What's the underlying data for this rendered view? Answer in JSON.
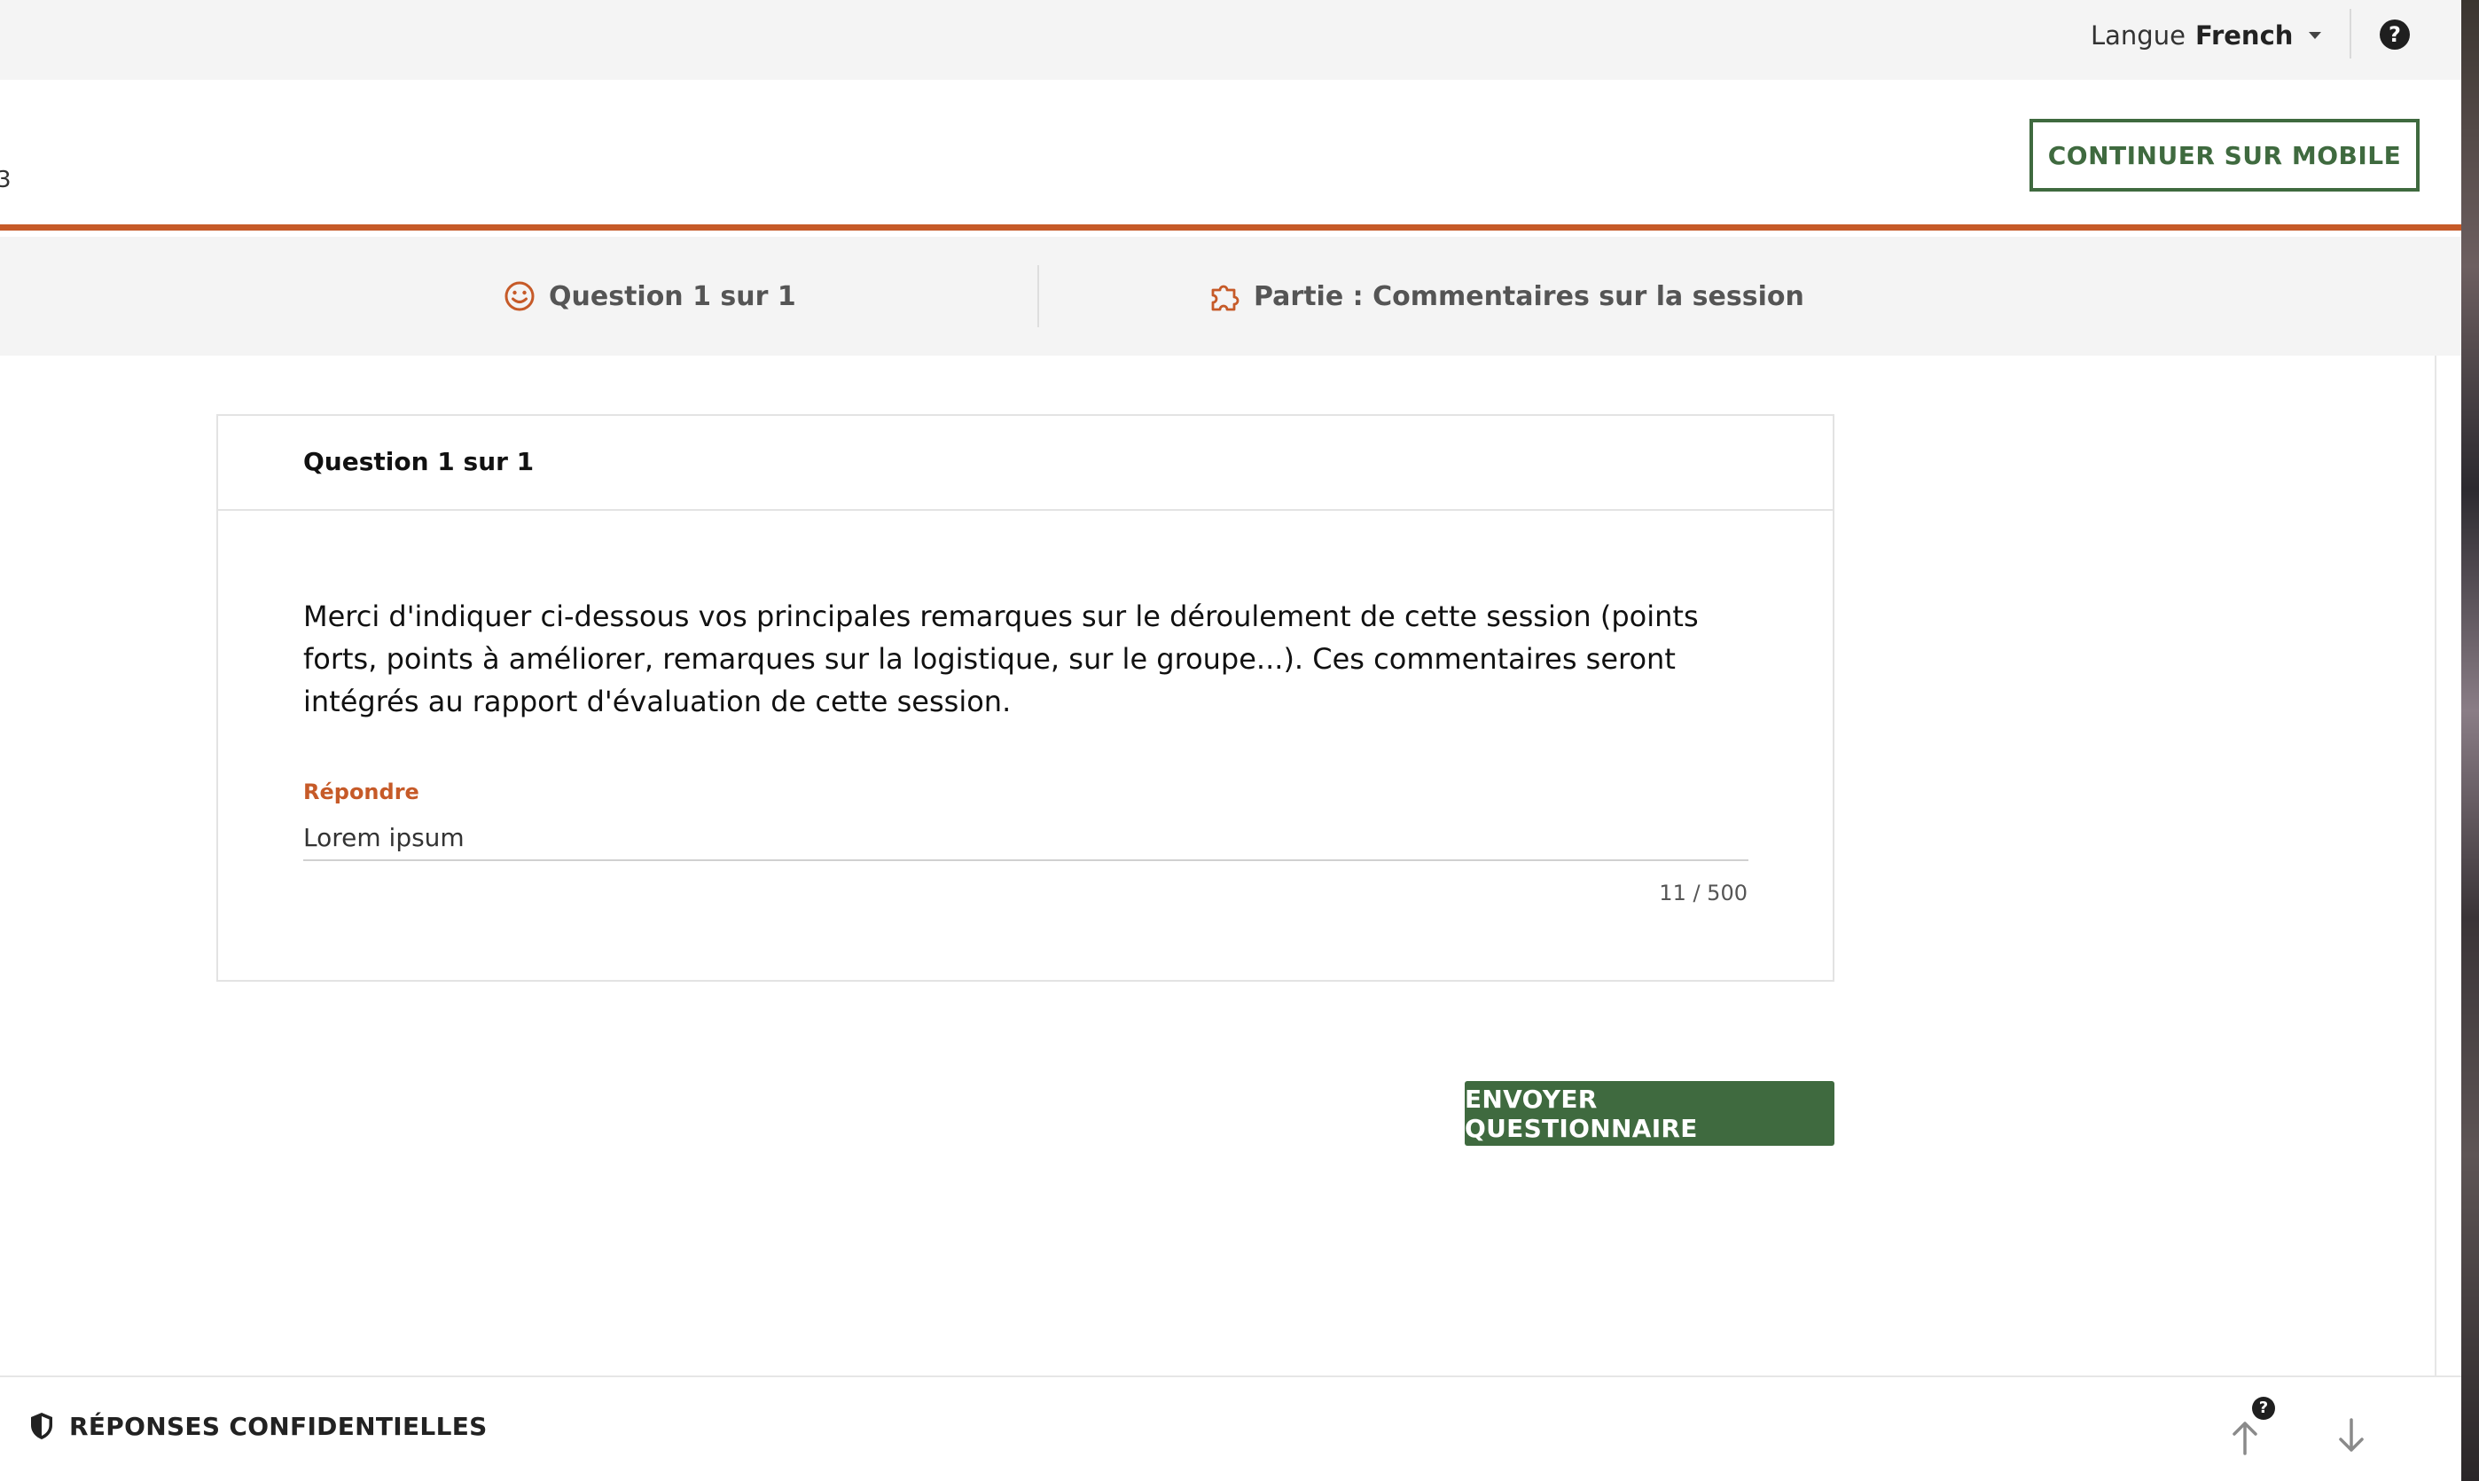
{
  "topbar": {
    "language_label": "Langue",
    "language_value": "French",
    "help_glyph": "?"
  },
  "header": {
    "edge_text": "3",
    "mobile_button": "CONTINUER SUR MOBILE"
  },
  "progress": {
    "question_label": "Question 1 sur 1",
    "part_label": "Partie : Commentaires sur la session"
  },
  "card": {
    "title": "Question 1 sur 1",
    "question": "Merci d'indiquer ci-dessous vos principales remarques sur le déroulement de cette session (points forts, points à améliorer, remarques sur la logistique, sur le groupe...). Ces commentaires seront intégrés au rapport d'évaluation de cette session.",
    "answer_label": "Répondre",
    "answer_value": "Lorem ipsum",
    "char_count": "11 / 500"
  },
  "submit_button": "ENVOYER QUESTIONNAIRE",
  "footer": {
    "confidential_label": "RÉPONSES CONFIDENTIELLES",
    "nav_help_glyph": "?"
  },
  "icons": {
    "progress_question": "smiley-icon",
    "progress_part": "puzzle-icon",
    "confidential": "shield-icon",
    "nav_up": "arrow-up-icon",
    "nav_down": "arrow-down-icon"
  },
  "colors": {
    "accent": "#c65a28",
    "primary_green": "#3f6a3f",
    "strip_background": "#f4f4f4"
  }
}
